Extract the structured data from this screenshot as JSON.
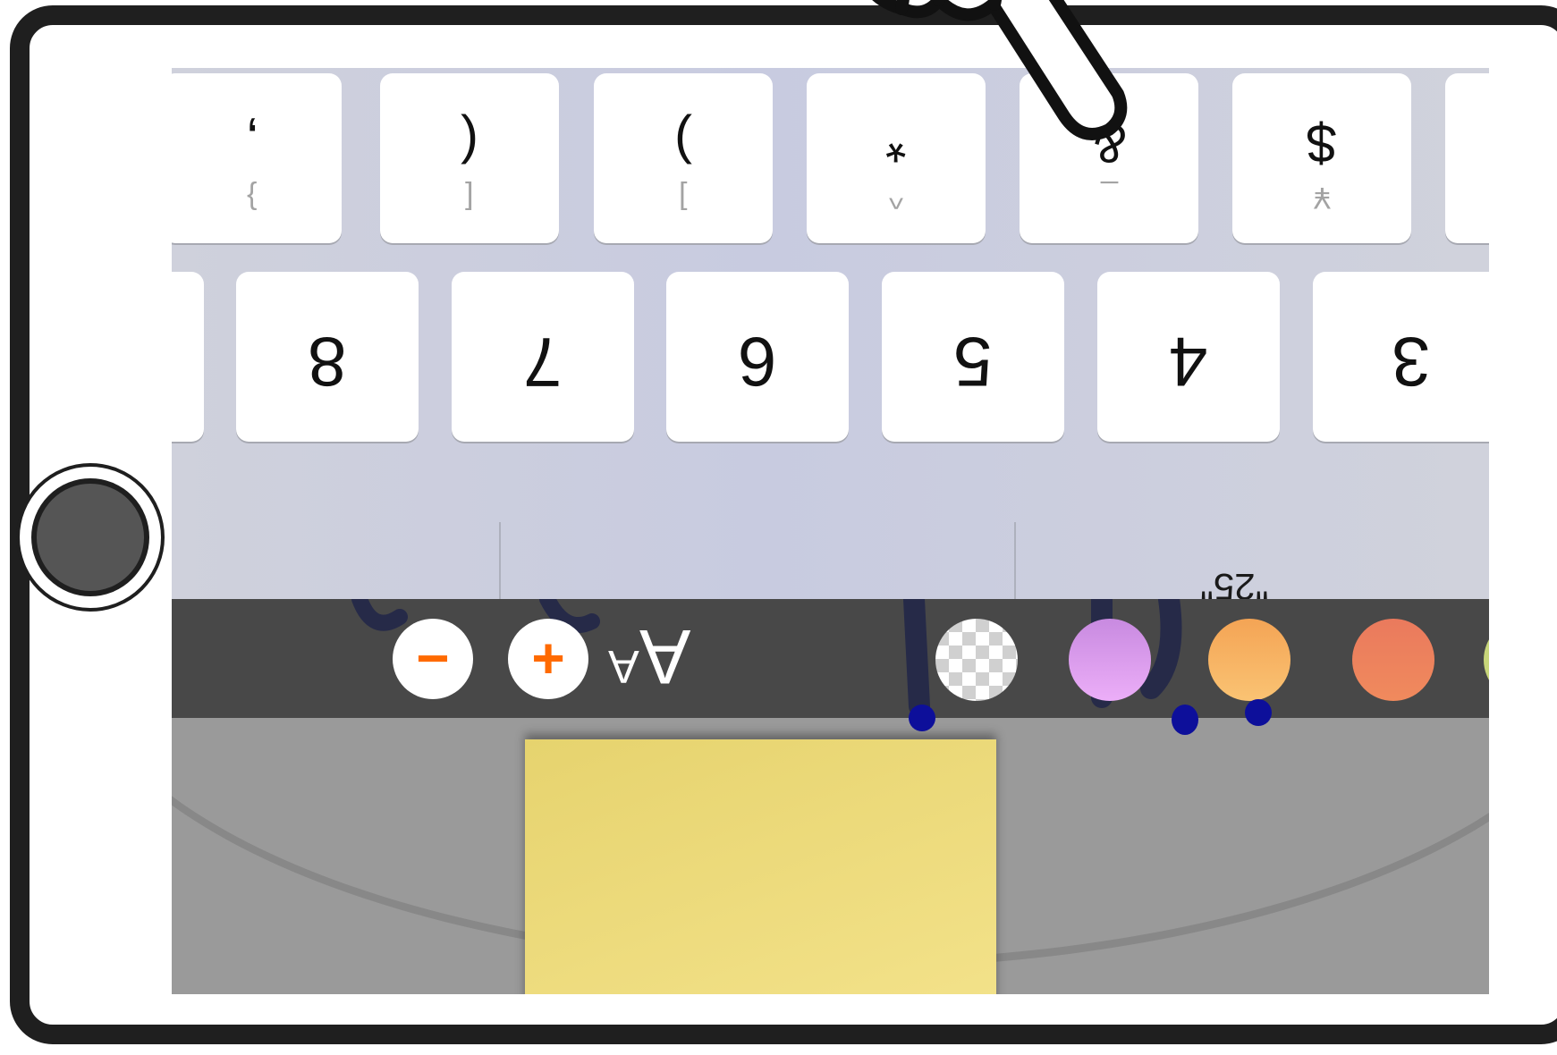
{
  "keyboard": {
    "symbol_row": [
      {
        "main": ",",
        "sub": "}"
      },
      {
        "main": "(",
        "sub": "["
      },
      {
        "main": ")",
        "sub": "]"
      },
      {
        "main": "*",
        "sub": "^"
      },
      {
        "main": "&",
        "sub": "_"
      },
      {
        "main": "$",
        "sub": "¥"
      },
      {
        "main": "",
        "sub": ""
      }
    ],
    "number_row": [
      "8",
      "7",
      "6",
      "5",
      "4",
      "3"
    ],
    "suggestions": [
      "",
      "",
      "\"25\""
    ]
  },
  "toolbar": {
    "decrease_label": "−",
    "increase_label": "+",
    "font_size_glyph": "A",
    "swatches": [
      {
        "name": "transparent",
        "color": "checker"
      },
      {
        "name": "purple",
        "color": "#d79cf0"
      },
      {
        "name": "orange",
        "color": "#f7ae5c"
      },
      {
        "name": "red-orange",
        "color": "#ee7a5c"
      },
      {
        "name": "yellow-green",
        "color": "#c8d67a"
      }
    ]
  },
  "canvas": {
    "note_color": "#f0de7f"
  }
}
